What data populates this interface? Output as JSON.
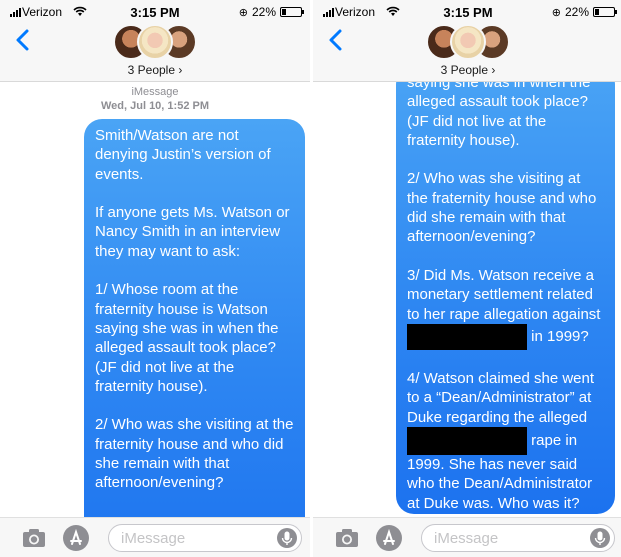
{
  "status": {
    "carrier": "Verizon",
    "time": "3:15 PM",
    "battery": "22%",
    "battery_level": 0.22
  },
  "header": {
    "people_label": "3 People",
    "chevron": "›"
  },
  "thread": {
    "service": "iMessage",
    "timestamp": "Wed, Jul 10, 1:52 PM"
  },
  "message": {
    "p1": "Smith/Watson are not denying Justin’s version of events.",
    "p2": "If anyone gets Ms. Watson or Nancy Smith in an interview they may want to ask:",
    "q1": "1/ Whose room at the fraternity house is Watson saying she was in when the alleged assault took place? (JF did not live at the fraternity house).",
    "q1_tail": "saying she was in when the alleged assault took place? (JF did not live at the fraternity house).",
    "q2": "2/ Who was she visiting at the fraternity house and who did she remain with that afternoon/evening?",
    "q3_a": "3/ Did Ms. Watson receive a monetary settlement related to her rape allegation against",
    "q3_b": "in 1999?",
    "q4_a": "4/ Watson claimed she went to a “Dean/Administrator” at Duke regarding the alleged",
    "q4_b": "rape in 1999. She has never said who the Dean/Administrator at Duke was. Who was it?"
  },
  "compose": {
    "placeholder": "iMessage"
  },
  "icons": {
    "back": "chevron-left-icon",
    "camera": "camera-icon",
    "apps": "app-store-icon",
    "mic": "microphone-icon",
    "wifi": "wifi-icon",
    "lock": "rotation-lock-icon"
  },
  "colors": {
    "bubble_top": "#4aa4f5",
    "bubble_bottom": "#1c72ef",
    "ios_blue": "#007aff"
  }
}
